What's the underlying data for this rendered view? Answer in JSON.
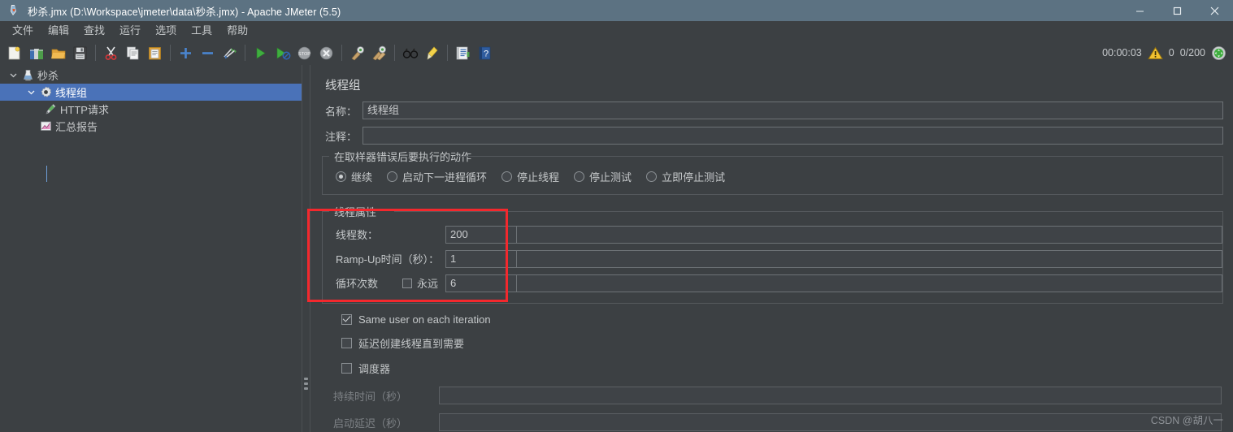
{
  "window": {
    "title": "秒杀.jmx (D:\\Workspace\\jmeter\\data\\秒杀.jmx) - Apache JMeter (5.5)",
    "titlebar_color": "#5c7282",
    "minimize": "—",
    "maximize": "□",
    "close": "✕"
  },
  "menubar": {
    "items": [
      {
        "label": "文件",
        "name": "menu-file"
      },
      {
        "label": "编辑",
        "name": "menu-edit"
      },
      {
        "label": "查找",
        "name": "menu-search"
      },
      {
        "label": "运行",
        "name": "menu-run"
      },
      {
        "label": "选项",
        "name": "menu-options"
      },
      {
        "label": "工具",
        "name": "menu-tools"
      },
      {
        "label": "帮助",
        "name": "menu-help"
      }
    ]
  },
  "toolbar": {
    "buttons": [
      {
        "icon": "new-document-icon"
      },
      {
        "icon": "templates-icon"
      },
      {
        "icon": "open-folder-icon"
      },
      {
        "icon": "save-icon"
      },
      {
        "icon": "cut-icon"
      },
      {
        "icon": "copy-icon"
      },
      {
        "icon": "paste-icon"
      },
      {
        "icon": "expand-all-icon"
      },
      {
        "icon": "collapse-all-icon"
      },
      {
        "icon": "toggle-icon"
      },
      {
        "icon": "start-icon"
      },
      {
        "icon": "start-no-pauses-icon"
      },
      {
        "icon": "stop-icon"
      },
      {
        "icon": "shutdown-icon"
      },
      {
        "icon": "clear-icon"
      },
      {
        "icon": "clear-all-icon"
      },
      {
        "icon": "search-icon"
      },
      {
        "icon": "reset-search-icon"
      },
      {
        "icon": "function-helper-icon"
      },
      {
        "icon": "help-icon"
      }
    ],
    "status": {
      "elapsed_time": "00:00:03",
      "warning_icon": "warning-triangle-icon",
      "error_count": "0",
      "thread_count": "0/200",
      "running_indicator": "green-circle-icon"
    }
  },
  "tree": {
    "nodes": [
      {
        "label": "秒杀",
        "icon": "test-plan-icon",
        "depth": 0,
        "expanded": true,
        "selected": false
      },
      {
        "label": "线程组",
        "icon": "thread-group-icon",
        "depth": 1,
        "expanded": true,
        "selected": true
      },
      {
        "label": "HTTP请求",
        "icon": "http-request-icon",
        "depth": 2,
        "expanded": false,
        "selected": false
      },
      {
        "label": "汇总报告",
        "icon": "summary-report-icon",
        "depth": 1,
        "expanded": false,
        "selected": false
      }
    ]
  },
  "panel": {
    "title": "线程组",
    "name_label": "名称：",
    "name_value": "线程组",
    "comment_label": "注释：",
    "comment_value": "",
    "error_action": {
      "group_title": "在取样器错误后要执行的动作",
      "options": [
        {
          "label": "继续",
          "selected": true
        },
        {
          "label": "启动下一进程循环",
          "selected": false
        },
        {
          "label": "停止线程",
          "selected": false
        },
        {
          "label": "停止测试",
          "selected": false
        },
        {
          "label": "立即停止测试",
          "selected": false
        }
      ]
    },
    "thread_properties": {
      "group_title": "线程属性",
      "threads_label": "线程数：",
      "threads_value": "200",
      "rampup_label": "Ramp-Up时间（秒）：",
      "rampup_value": "1",
      "loops_label": "循环次数",
      "loops_forever_label": "永远",
      "loops_forever_checked": false,
      "loops_value": "6",
      "highlight_color": "#f3282d"
    },
    "options": [
      {
        "label": "Same user on each iteration",
        "checked": true
      },
      {
        "label": "延迟创建线程直到需要",
        "checked": false
      },
      {
        "label": "调度器",
        "checked": false
      }
    ],
    "scheduler": {
      "duration_label": "持续时间（秒）",
      "duration_value": "",
      "startup_delay_label": "启动延迟（秒）",
      "startup_delay_value": ""
    }
  },
  "watermark": "CSDN @胡八一"
}
